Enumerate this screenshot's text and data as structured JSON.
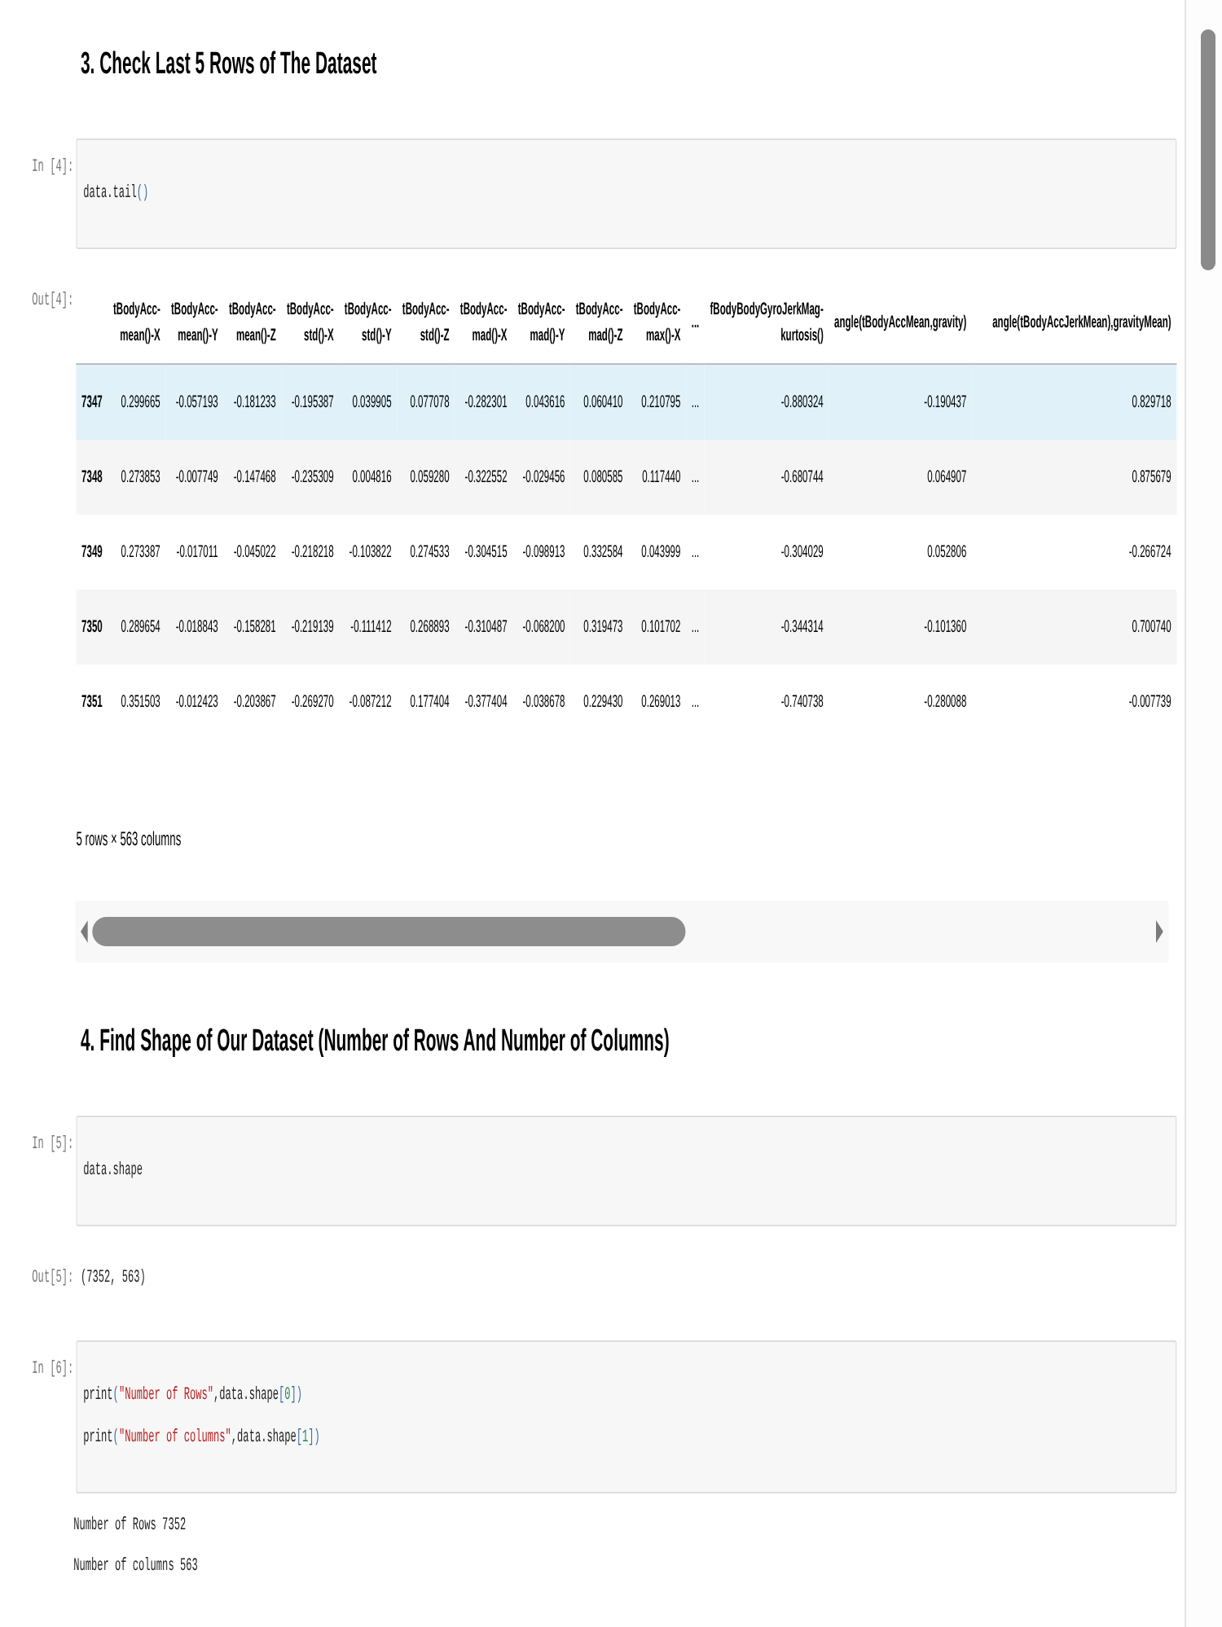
{
  "cells": [
    {
      "kind": "markdown",
      "heading": "3. Check Last 5 Rows of The Dataset"
    },
    {
      "kind": "code",
      "prompt": "In [4]:",
      "lines": [
        [
          {
            "kind": "name",
            "text": "data.tail"
          },
          {
            "kind": "bracket",
            "text": "()"
          }
        ]
      ]
    },
    {
      "kind": "dataframe",
      "prompt": "Out[4]:",
      "columns": [
        "tBodyAcc-mean()-X",
        "tBodyAcc-mean()-Y",
        "tBodyAcc-mean()-Z",
        "tBodyAcc-std()-X",
        "tBodyAcc-std()-Y",
        "tBodyAcc-std()-Z",
        "tBodyAcc-mad()-X",
        "tBodyAcc-mad()-Y",
        "tBodyAcc-mad()-Z",
        "tBodyAcc-max()-X",
        "...",
        "fBodyBodyGyroJerkMag-kurtosis()",
        "angle(tBodyAccMean,gravity)",
        "angle(tBodyAccJerkMean),gravityMean)"
      ],
      "rows": [
        {
          "index": "7347",
          "highlighted": true,
          "cells": [
            "0.299665",
            "-0.057193",
            "-0.181233",
            "-0.195387",
            "0.039905",
            "0.077078",
            "-0.282301",
            "0.043616",
            "0.060410",
            "0.210795",
            "...",
            "-0.880324",
            "-0.190437",
            "0.829718"
          ]
        },
        {
          "index": "7348",
          "highlighted": false,
          "cells": [
            "0.273853",
            "-0.007749",
            "-0.147468",
            "-0.235309",
            "0.004816",
            "0.059280",
            "-0.322552",
            "-0.029456",
            "0.080585",
            "0.117440",
            "...",
            "-0.680744",
            "0.064907",
            "0.875679"
          ]
        },
        {
          "index": "7349",
          "highlighted": false,
          "cells": [
            "0.273387",
            "-0.017011",
            "-0.045022",
            "-0.218218",
            "-0.103822",
            "0.274533",
            "-0.304515",
            "-0.098913",
            "0.332584",
            "0.043999",
            "...",
            "-0.304029",
            "0.052806",
            "-0.266724"
          ]
        },
        {
          "index": "7350",
          "highlighted": false,
          "cells": [
            "0.289654",
            "-0.018843",
            "-0.158281",
            "-0.219139",
            "-0.111412",
            "0.268893",
            "-0.310487",
            "-0.068200",
            "0.319473",
            "0.101702",
            "...",
            "-0.344314",
            "-0.101360",
            "0.700740"
          ]
        },
        {
          "index": "7351",
          "highlighted": false,
          "cells": [
            "0.351503",
            "-0.012423",
            "-0.203867",
            "-0.269270",
            "-0.087212",
            "0.177404",
            "-0.377404",
            "-0.038678",
            "0.229430",
            "0.269013",
            "...",
            "-0.740738",
            "-0.280088",
            "-0.007739"
          ]
        }
      ],
      "summary": "5 rows × 563 columns"
    },
    {
      "kind": "markdown",
      "heading": "4. Find Shape of Our Dataset (Number of Rows And Number of Columns)"
    },
    {
      "kind": "code",
      "prompt": "In [5]:",
      "lines": [
        [
          {
            "kind": "name",
            "text": "data.shape"
          }
        ]
      ]
    },
    {
      "kind": "result",
      "prompt": "Out[5]:",
      "text": "(7352, 563)"
    },
    {
      "kind": "code",
      "prompt": "In [6]:",
      "lines": [
        [
          {
            "kind": "name",
            "text": "print"
          },
          {
            "kind": "bracket",
            "text": "("
          },
          {
            "kind": "string",
            "text": "\"Number of Rows\""
          },
          {
            "kind": "name",
            "text": ",data.shape"
          },
          {
            "kind": "bracket",
            "text": "["
          },
          {
            "kind": "number",
            "text": "0"
          },
          {
            "kind": "bracket",
            "text": "])"
          }
        ],
        [
          {
            "kind": "name",
            "text": "print"
          },
          {
            "kind": "bracket",
            "text": "("
          },
          {
            "kind": "string",
            "text": "\"Number of columns\""
          },
          {
            "kind": "name",
            "text": ",data.shape"
          },
          {
            "kind": "bracket",
            "text": "["
          },
          {
            "kind": "number",
            "text": "1"
          },
          {
            "kind": "bracket",
            "text": "])"
          }
        ]
      ]
    },
    {
      "kind": "stream",
      "lines": [
        "Number of Rows 7352",
        "Number of columns 563"
      ]
    }
  ]
}
